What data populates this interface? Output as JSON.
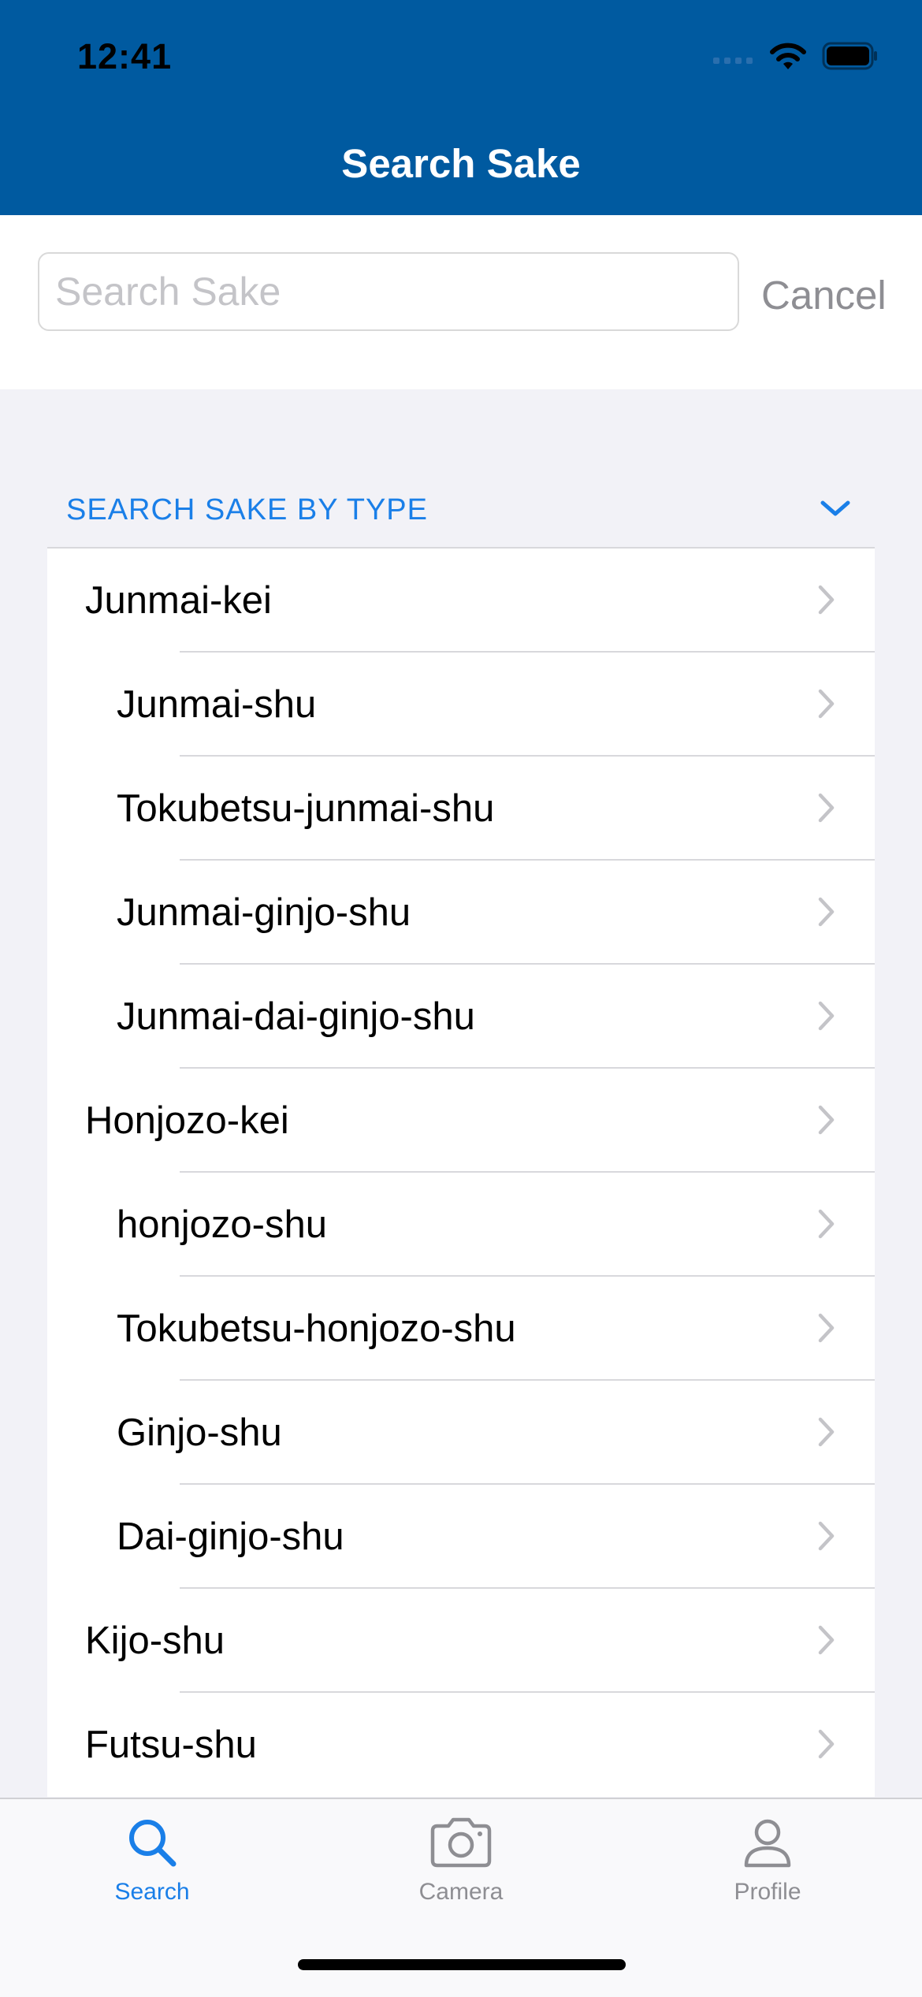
{
  "status_bar": {
    "time": "12:41"
  },
  "nav": {
    "title": "Search Sake"
  },
  "search": {
    "placeholder": "Search Sake",
    "value": "",
    "cancel_label": "Cancel"
  },
  "section": {
    "title": "SEARCH SAKE BY TYPE",
    "icon": "chevron-down-icon"
  },
  "list": {
    "items": [
      {
        "label": "Junmai-kei",
        "level": 0
      },
      {
        "label": "Junmai-shu",
        "level": 1
      },
      {
        "label": "Tokubetsu-junmai-shu",
        "level": 1
      },
      {
        "label": "Junmai-ginjo-shu",
        "level": 1
      },
      {
        "label": "Junmai-dai-ginjo-shu",
        "level": 1
      },
      {
        "label": "Honjozo-kei",
        "level": 0
      },
      {
        "label": "honjozo-shu",
        "level": 1
      },
      {
        "label": "Tokubetsu-honjozo-shu",
        "level": 1
      },
      {
        "label": "Ginjo-shu",
        "level": 1
      },
      {
        "label": "Dai-ginjo-shu",
        "level": 1
      },
      {
        "label": "Kijo-shu",
        "level": 0
      },
      {
        "label": "Futsu-shu",
        "level": 0
      }
    ]
  },
  "tabbar": {
    "tabs": [
      {
        "label": "Search",
        "icon": "search-icon",
        "active": true
      },
      {
        "label": "Camera",
        "icon": "camera-icon",
        "active": false
      },
      {
        "label": "Profile",
        "icon": "profile-icon",
        "active": false
      }
    ]
  },
  "colors": {
    "header": "#005aa0",
    "accent": "#1a7fe8",
    "inactive": "#8e8e93"
  }
}
